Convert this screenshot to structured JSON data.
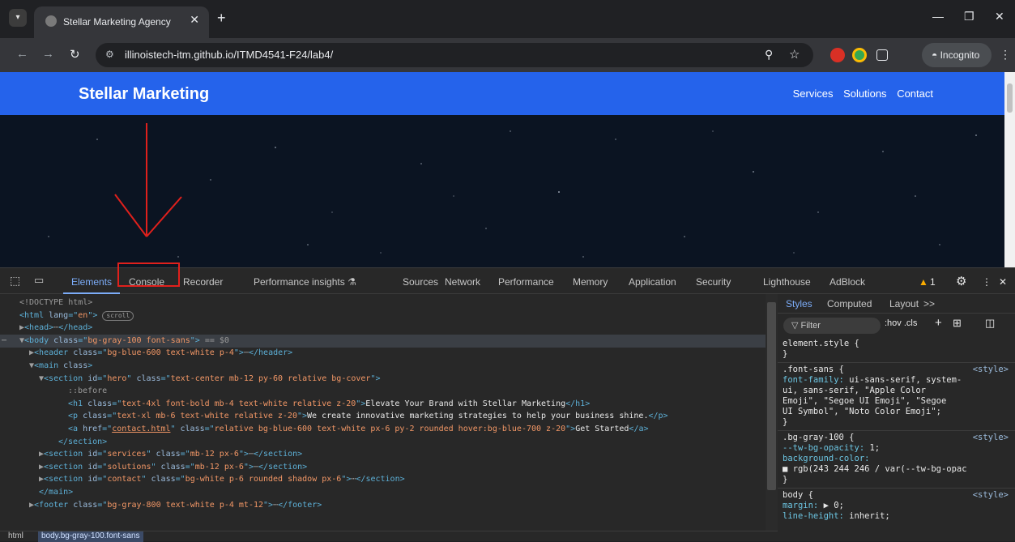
{
  "browser": {
    "tab_title": "Stellar Marketing Agency",
    "tab_close": "✕",
    "new_tab": "+",
    "url": "illinoistech-itm.github.io/ITMD4541-F24/lab4/",
    "incognito_label": "Incognito",
    "win_min": "—",
    "win_restore": "❐",
    "win_close": "✕"
  },
  "site": {
    "brand": "Stellar Marketing",
    "nav": [
      "Services",
      "Solutions",
      "Contact"
    ]
  },
  "devtools": {
    "tabs": [
      "Elements",
      "Console",
      "Recorder",
      "Performance insights",
      "Sources",
      "Network",
      "Performance",
      "Memory",
      "Application",
      "Security",
      "Lighthouse",
      "AdBlock"
    ],
    "active_tab": "Elements",
    "warning_count": "1",
    "dom": [
      {
        "indent": 0,
        "parts": [
          [
            "gray",
            "<!DOCTYPE html>"
          ]
        ]
      },
      {
        "indent": 0,
        "parts": [
          [
            "tag",
            "<html "
          ],
          [
            "attr",
            "lang"
          ],
          [
            "tag",
            "=\""
          ],
          [
            "val",
            "en"
          ],
          [
            "tag",
            "\">"
          ]
        ],
        "pill": "scroll"
      },
      {
        "indent": 1,
        "tri": "▶",
        "parts": [
          [
            "tag",
            "<head>"
          ],
          [
            "gray",
            "⋯"
          ],
          [
            "tag",
            "</head>"
          ]
        ]
      },
      {
        "indent": 1,
        "tri": "▼",
        "sel": true,
        "parts": [
          [
            "tag",
            "<body "
          ],
          [
            "attr",
            "class"
          ],
          [
            "tag",
            "=\""
          ],
          [
            "val",
            "bg-gray-100 font-sans"
          ],
          [
            "tag",
            "\">"
          ],
          [
            "gray",
            " == $0"
          ]
        ]
      },
      {
        "indent": 2,
        "tri": "▶",
        "parts": [
          [
            "tag",
            "<header "
          ],
          [
            "attr",
            "class"
          ],
          [
            "tag",
            "=\""
          ],
          [
            "val",
            "bg-blue-600 text-white p-4"
          ],
          [
            "tag",
            "\">"
          ],
          [
            "gray",
            "⋯"
          ],
          [
            "tag",
            "</header>"
          ]
        ]
      },
      {
        "indent": 2,
        "tri": "▼",
        "parts": [
          [
            "tag",
            "<main "
          ],
          [
            "attr",
            "class"
          ],
          [
            "tag",
            ">"
          ]
        ]
      },
      {
        "indent": 3,
        "tri": "▼",
        "parts": [
          [
            "tag",
            "<section "
          ],
          [
            "attr",
            "id"
          ],
          [
            "tag",
            "=\""
          ],
          [
            "val",
            "hero"
          ],
          [
            "tag",
            "\" "
          ],
          [
            "attr",
            "class"
          ],
          [
            "tag",
            "=\""
          ],
          [
            "val",
            "text-center mb-12 py-60 relative bg-cover"
          ],
          [
            "tag",
            "\">"
          ]
        ]
      },
      {
        "indent": 5,
        "parts": [
          [
            "gray",
            "::before"
          ]
        ]
      },
      {
        "indent": 5,
        "parts": [
          [
            "tag",
            "<h1 "
          ],
          [
            "attr",
            "class"
          ],
          [
            "tag",
            "=\""
          ],
          [
            "val",
            "text-4xl font-bold mb-4 text-white relative z-20"
          ],
          [
            "tag",
            "\">"
          ],
          [
            "txt",
            "Elevate Your Brand with Stellar Marketing"
          ],
          [
            "tag",
            "</h1>"
          ]
        ]
      },
      {
        "indent": 5,
        "parts": [
          [
            "tag",
            "<p "
          ],
          [
            "attr",
            "class"
          ],
          [
            "tag",
            "=\""
          ],
          [
            "val",
            "text-xl mb-6 text-white relative z-20"
          ],
          [
            "tag",
            "\">"
          ],
          [
            "txt",
            "We create innovative marketing strategies to help your business shine."
          ],
          [
            "tag",
            "</p>"
          ]
        ]
      },
      {
        "indent": 5,
        "parts": [
          [
            "tag",
            "<a "
          ],
          [
            "attr",
            "href"
          ],
          [
            "tag",
            "=\""
          ],
          [
            "val",
            "contact.html"
          ],
          [
            "tag",
            "\" "
          ],
          [
            "attr",
            "class"
          ],
          [
            "tag",
            "=\""
          ],
          [
            "val",
            "relative bg-blue-600 text-white px-6 py-2 rounded hover:bg-blue-700 z-20"
          ],
          [
            "tag",
            "\">"
          ],
          [
            "txt",
            "Get Started"
          ],
          [
            "tag",
            "</a>"
          ]
        ]
      },
      {
        "indent": 4,
        "parts": [
          [
            "tag",
            "</section>"
          ]
        ]
      },
      {
        "indent": 3,
        "tri": "▶",
        "parts": [
          [
            "tag",
            "<section "
          ],
          [
            "attr",
            "id"
          ],
          [
            "tag",
            "=\""
          ],
          [
            "val",
            "services"
          ],
          [
            "tag",
            "\" "
          ],
          [
            "attr",
            "class"
          ],
          [
            "tag",
            "=\""
          ],
          [
            "val",
            "mb-12 px-6"
          ],
          [
            "tag",
            "\">"
          ],
          [
            "gray",
            "⋯"
          ],
          [
            "tag",
            "</section>"
          ]
        ]
      },
      {
        "indent": 3,
        "tri": "▶",
        "parts": [
          [
            "tag",
            "<section "
          ],
          [
            "attr",
            "id"
          ],
          [
            "tag",
            "=\""
          ],
          [
            "val",
            "solutions"
          ],
          [
            "tag",
            "\" "
          ],
          [
            "attr",
            "class"
          ],
          [
            "tag",
            "=\""
          ],
          [
            "val",
            "mb-12 px-6"
          ],
          [
            "tag",
            "\">"
          ],
          [
            "gray",
            "⋯"
          ],
          [
            "tag",
            "</section>"
          ]
        ]
      },
      {
        "indent": 3,
        "tri": "▶",
        "parts": [
          [
            "tag",
            "<section "
          ],
          [
            "attr",
            "id"
          ],
          [
            "tag",
            "=\""
          ],
          [
            "val",
            "contact"
          ],
          [
            "tag",
            "\" "
          ],
          [
            "attr",
            "class"
          ],
          [
            "tag",
            "=\""
          ],
          [
            "val",
            "bg-white p-6 rounded shadow px-6"
          ],
          [
            "tag",
            "\">"
          ],
          [
            "gray",
            "⋯"
          ],
          [
            "tag",
            "</section>"
          ]
        ]
      },
      {
        "indent": 2,
        "parts": [
          [
            "tag",
            "</main>"
          ]
        ]
      },
      {
        "indent": 2,
        "tri": "▶",
        "parts": [
          [
            "tag",
            "<footer "
          ],
          [
            "attr",
            "class"
          ],
          [
            "tag",
            "=\""
          ],
          [
            "val",
            "bg-gray-800 text-white p-4 mt-12"
          ],
          [
            "tag",
            "\">"
          ],
          [
            "gray",
            "⋯"
          ],
          [
            "tag",
            "</footer>"
          ]
        ]
      }
    ],
    "styles_tabs": [
      "Styles",
      "Computed",
      "Layout",
      ">>"
    ],
    "filter_placeholder": "Filter",
    "hov_cls": ":hov .cls",
    "rules": [
      {
        "selector": "element.style {",
        "lines": [
          "}"
        ]
      },
      {
        "selector": ".font-sans {",
        "source": "<style>",
        "lines": [
          "  font-family: ui-sans-serif, system-",
          "     ui, sans-serif, \"Apple Color",
          "     Emoji\", \"Segoe UI Emoji\", \"Segoe",
          "     UI Symbol\", \"Noto Color Emoji\";",
          "}"
        ]
      },
      {
        "selector": ".bg-gray-100 {",
        "source": "<style>",
        "lines": [
          "  --tw-bg-opacity: 1;",
          "  background-color:",
          "     ■ rgb(243 244 246 / var(--tw-bg-opac",
          "}"
        ]
      },
      {
        "selector": "body {",
        "source": "<style>",
        "lines": [
          "  margin: ▶ 0;",
          "  line-height: inherit;"
        ]
      }
    ],
    "breadcrumbs": [
      "html",
      "body.bg-gray-100.font-sans"
    ]
  },
  "colors": {
    "site_header": "#2563eb",
    "annotation_red": "#e0201c"
  }
}
